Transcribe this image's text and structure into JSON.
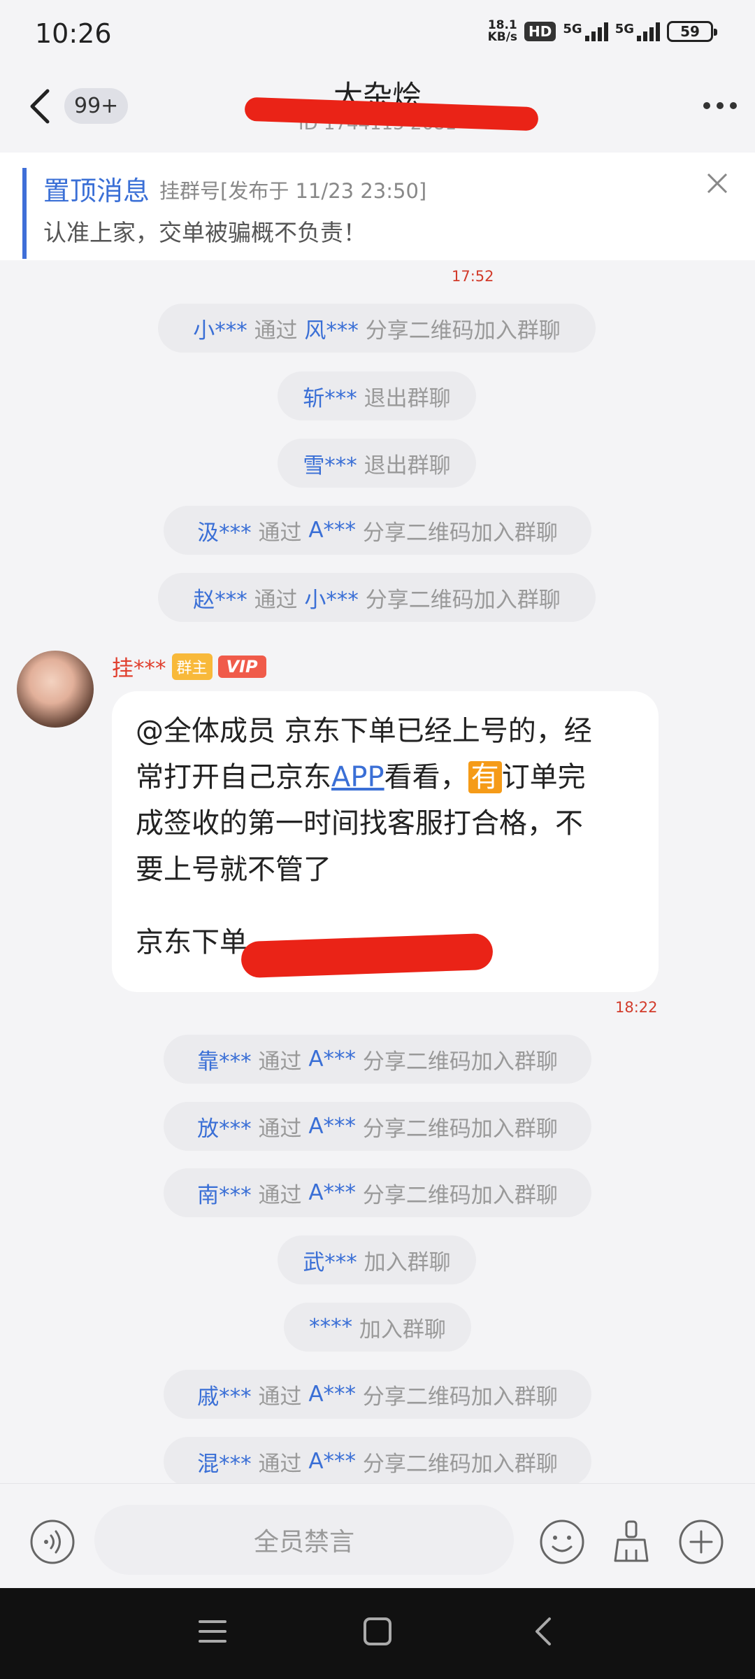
{
  "status": {
    "time": "10:26",
    "net_speed_value": "18.1",
    "net_speed_unit": "KB/s",
    "hd": "HD",
    "sig1": "5G",
    "sig2": "5G",
    "battery": "59"
  },
  "header": {
    "badge": "99+",
    "title": "大杂烩",
    "subtitle": "ID 1744115 2681",
    "redacted": true
  },
  "pinned": {
    "label": "置顶消息",
    "meta": "挂群号[发布于 11/23 23:50]",
    "text": "认准上家，交单被骗概不负责！"
  },
  "timestamps": {
    "t1": "17:52",
    "t2": "18:22"
  },
  "system_messages_top": [
    {
      "user": "小***",
      "via": "通过",
      "inviter": "风***",
      "action": "分享二维码加入群聊"
    },
    {
      "user": "斩***",
      "via": "",
      "inviter": "",
      "action": "退出群聊"
    },
    {
      "user": "雪***",
      "via": "",
      "inviter": "",
      "action": "退出群聊"
    },
    {
      "user": "汲***",
      "via": "通过",
      "inviter": "A***",
      "action": "分享二维码加入群聊"
    },
    {
      "user": "赵***",
      "via": "通过",
      "inviter": "小***",
      "action": "分享二维码加入群聊"
    }
  ],
  "message": {
    "sender": "挂***",
    "owner_tag": "群主",
    "vip_tag": "VIP",
    "line1": "@全体成员 京东下单已经上号的，经",
    "line2_a": "常打开自己京东",
    "line2_link": "APP",
    "line2_b": "看看，",
    "line2_you": "有",
    "line2_c": "订单完",
    "line3": "成签收的第一时间找客服打合格，不",
    "line4": "要上号就不管了",
    "line5": "京东下单"
  },
  "system_messages_bottom": [
    {
      "user": "靠***",
      "via": "通过",
      "inviter": "A***",
      "action": "分享二维码加入群聊"
    },
    {
      "user": "放***",
      "via": "通过",
      "inviter": "A***",
      "action": "分享二维码加入群聊"
    },
    {
      "user": "南***",
      "via": "通过",
      "inviter": "A***",
      "action": "分享二维码加入群聊"
    },
    {
      "user": "武***",
      "via": "",
      "inviter": "",
      "action": "加入群聊"
    },
    {
      "user": "****",
      "via": "",
      "inviter": "",
      "action": "加入群聊"
    },
    {
      "user": "戚***",
      "via": "通过",
      "inviter": "A***",
      "action": "分享二维码加入群聊"
    },
    {
      "user": "混***",
      "via": "通过",
      "inviter": "A***",
      "action": "分享二维码加入群聊"
    }
  ],
  "input": {
    "placeholder": "全员禁言"
  },
  "colors": {
    "accent": "#3a6fd6",
    "timestamp": "#d23b2b",
    "redaction": "#ea2317"
  },
  "icons": [
    "back-arrow-icon",
    "more-icon",
    "close-icon",
    "voice-icon",
    "emoji-icon",
    "broom-icon",
    "plus-icon",
    "menu-icon",
    "home-icon",
    "nav-back-icon"
  ]
}
